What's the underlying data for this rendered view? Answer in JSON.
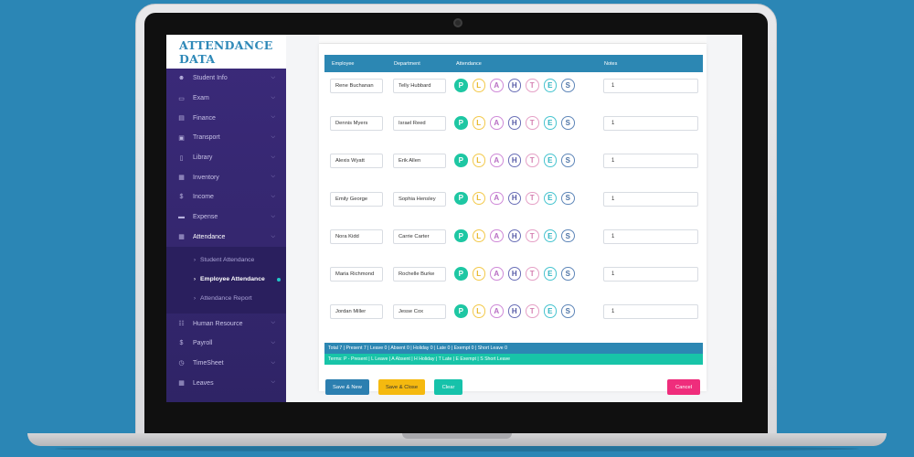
{
  "brand": {
    "line1": "ATTENDANCE",
    "line2": "DATA"
  },
  "sidebar": {
    "items": [
      {
        "label": "Student Info",
        "icon": "users-icon"
      },
      {
        "label": "Exam",
        "icon": "monitor-icon"
      },
      {
        "label": "Finance",
        "icon": "money-icon"
      },
      {
        "label": "Transport",
        "icon": "bus-icon"
      },
      {
        "label": "Library",
        "icon": "book-icon"
      },
      {
        "label": "Inventory",
        "icon": "box-icon"
      },
      {
        "label": "Income",
        "icon": "dollar-icon"
      },
      {
        "label": "Expense",
        "icon": "card-icon"
      },
      {
        "label": "Attendance",
        "icon": "calendar-icon"
      }
    ],
    "sub_items": [
      {
        "label": "Student Attendance"
      },
      {
        "label": "Employee Attendance"
      },
      {
        "label": "Attendance Report"
      }
    ],
    "items_after": [
      {
        "label": "Human Resource",
        "icon": "org-icon"
      },
      {
        "label": "Payroll",
        "icon": "dollar-icon"
      },
      {
        "label": "TimeSheet",
        "icon": "clock-icon"
      },
      {
        "label": "Leaves",
        "icon": "calendar-icon"
      }
    ]
  },
  "table": {
    "headers": {
      "employee": "Employee",
      "department": "Department",
      "attendance": "Attendance",
      "notes": "Notes"
    },
    "attendance_codes": [
      "P",
      "L",
      "A",
      "H",
      "T",
      "E",
      "S"
    ],
    "rows": [
      {
        "employee": "Rene Buchanan",
        "department": "Telly Hubbard",
        "notes": "1"
      },
      {
        "employee": "Dennis Myers",
        "department": "Israel Reed",
        "notes": "1"
      },
      {
        "employee": "Alexis Wyatt",
        "department": "Erik Allen",
        "notes": "1"
      },
      {
        "employee": "Emily George",
        "department": "Sophia Hensley",
        "notes": "1"
      },
      {
        "employee": "Nora Kidd",
        "department": "Carrie Carter",
        "notes": "1"
      },
      {
        "employee": "Maria Richmond",
        "department": "Rochelle Burke",
        "notes": "1"
      },
      {
        "employee": "Jordan Miller",
        "department": "Jesse Cox",
        "notes": "1"
      }
    ]
  },
  "totals": "Total 7 | Present 7 | Leave 0 | Absent 0 | Holiday 0 | Late 0 | Exempt 0 | Short Leave 0",
  "terms": "Terms: P - Present | L Leave | A Absent | H Holiday | T Late | E Exempt | S Short Leave",
  "buttons": {
    "save_new": "Save & New",
    "save_close": "Save & Close",
    "clear": "Clear",
    "cancel": "Cancel"
  }
}
